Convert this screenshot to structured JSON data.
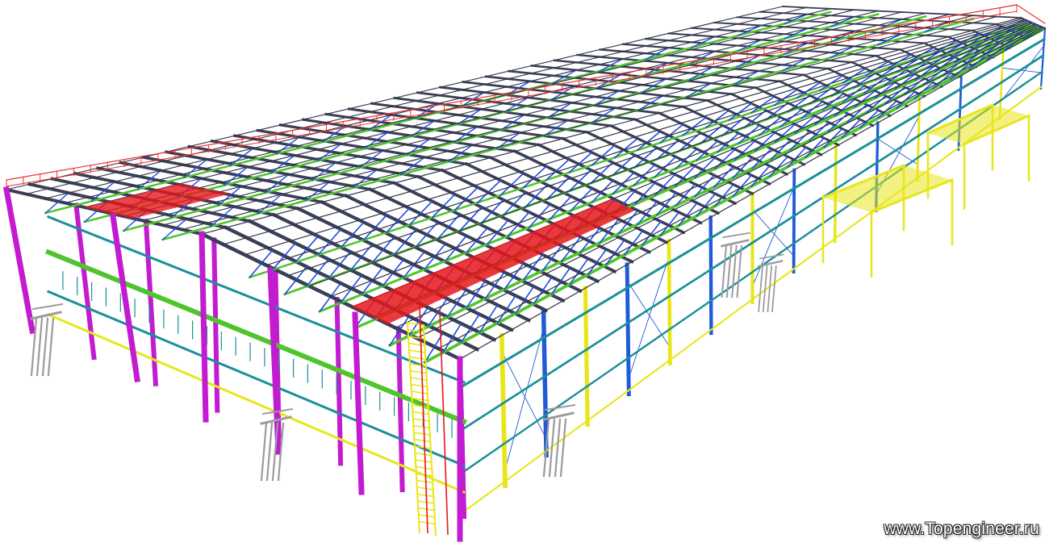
{
  "watermark": "www.Topengineer.ru",
  "colors": {
    "column": "#c21bd0",
    "column_blue": "#1f5bd6",
    "rafter": "#3b3f55",
    "purlin": "#2f3447",
    "truss_chord": "#4fc52d",
    "truss_web": "#1d48e0",
    "bracing_red": "#e5161b",
    "guardrail": "#ee2f2f",
    "girt_teal": "#1b8f9a",
    "yellow": "#e8e61a",
    "grey": "#9b9b9b",
    "panel_blue": "#2d6bd8",
    "background": "#ffffff"
  }
}
